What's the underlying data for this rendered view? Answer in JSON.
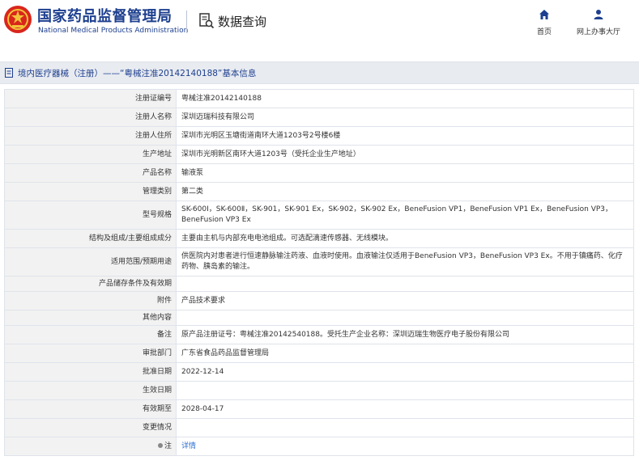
{
  "header": {
    "org_name_cn": "国家药品监督管理局",
    "org_name_en": "National Medical Products Administration",
    "query_label": "数据查询",
    "nav": [
      {
        "label": "首页",
        "icon": "home-icon"
      },
      {
        "label": "网上办事大厅",
        "icon": "user-icon"
      }
    ]
  },
  "title_bar": {
    "text": "境内医疗器械（注册）——“粤械注准20142140188”基本信息"
  },
  "rows": [
    {
      "label": "注册证编号",
      "value": "粤械注准20142140188"
    },
    {
      "label": "注册人名称",
      "value": "深圳迈瑞科技有限公司"
    },
    {
      "label": "注册人住所",
      "value": "深圳市光明区玉塘街道南环大道1203号2号楼6楼"
    },
    {
      "label": "生产地址",
      "value": "深圳市光明新区南环大道1203号（受托企业生产地址）"
    },
    {
      "label": "产品名称",
      "value": "输液泵"
    },
    {
      "label": "管理类别",
      "value": "第二类"
    },
    {
      "label": "型号规格",
      "value": "SK-600Ⅰ，SK-600Ⅱ，SK-901，SK-901 Ex，SK-902，SK-902 Ex，BeneFusion VP1，BeneFusion VP1 Ex，BeneFusion VP3，BeneFusion VP3 Ex"
    },
    {
      "label": "结构及组成/主要组成成分",
      "value": "主要由主机与内部充电电池组成。可选配滴速传感器、无线模块。"
    },
    {
      "label": "适用范围/预期用途",
      "value": "供医院内对患者进行恒速静脉输注药液、血液时使用。血液输注仅适用于BeneFusion VP3，BeneFusion VP3 Ex。不用于镇痛药、化疗药物、胰岛素的输注。"
    },
    {
      "label": "产品储存条件及有效期",
      "value": ""
    },
    {
      "label": "附件",
      "value": "产品技术要求"
    },
    {
      "label": "其他内容",
      "value": ""
    },
    {
      "label": "备注",
      "value": "原产品注册证号：粤械注准20142540188。受托生产企业名称：深圳迈瑞生物医疗电子股份有限公司"
    },
    {
      "label": "审批部门",
      "value": "广东省食品药品监督管理局"
    },
    {
      "label": "批准日期",
      "value": "2022-12-14"
    },
    {
      "label": "生效日期",
      "value": ""
    },
    {
      "label": "有效期至",
      "value": "2028-04-17"
    },
    {
      "label": "变更情况",
      "value": ""
    },
    {
      "label": "注",
      "value": "详情"
    }
  ]
}
